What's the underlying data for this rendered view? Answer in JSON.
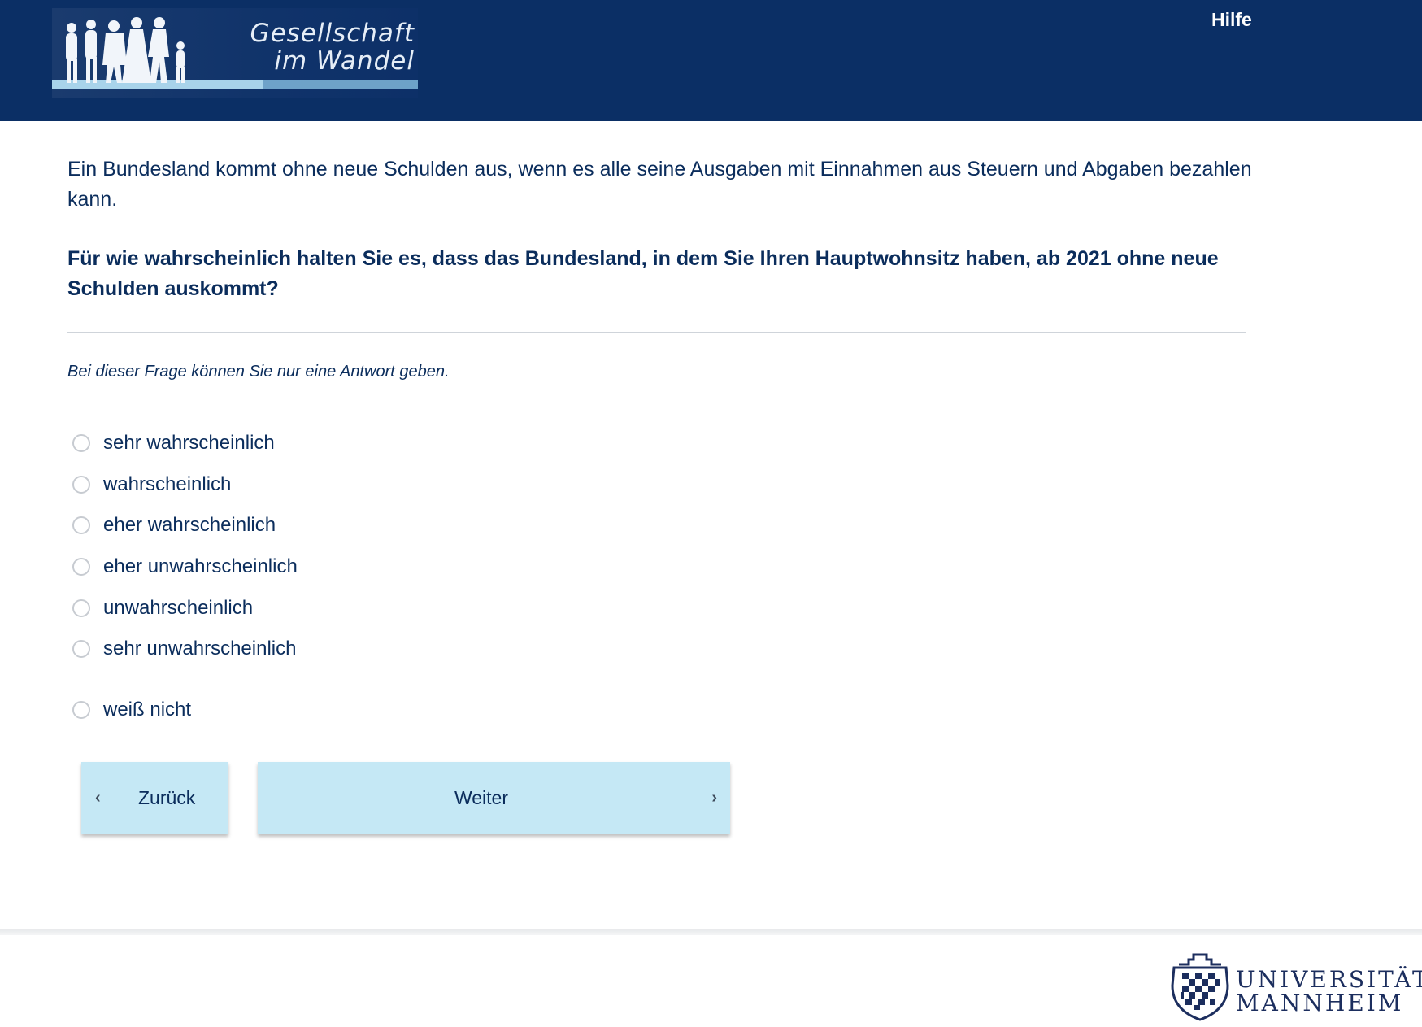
{
  "header": {
    "logo_title_line1": "Gesellschaft",
    "logo_title_line2": "im Wandel",
    "help_label": "Hilfe"
  },
  "main": {
    "intro": "Ein Bundesland kommt ohne neue Schulden aus, wenn es alle seine Ausgaben mit Einnahmen aus Steuern und Abgaben bezahlen kann.",
    "question": "Für wie wahrscheinlich halten Sie es, dass das Bundesland, in dem Sie Ihren Hauptwohnsitz haben, ab 2021 ohne neue Schulden auskommt?",
    "hint": "Bei dieser Frage können Sie nur eine Antwort geben.",
    "options": [
      {
        "label": "sehr wahrscheinlich",
        "selected": false
      },
      {
        "label": "wahrscheinlich",
        "selected": false
      },
      {
        "label": "eher wahrscheinlich",
        "selected": false
      },
      {
        "label": "eher unwahrscheinlich",
        "selected": false
      },
      {
        "label": "unwahrscheinlich",
        "selected": false
      },
      {
        "label": "sehr unwahrscheinlich",
        "selected": false
      },
      {
        "label": "weiß nicht",
        "selected": false
      }
    ]
  },
  "nav": {
    "back_label": "Zurück",
    "back_icon": "‹",
    "next_label": "Weiter",
    "next_icon": "›"
  },
  "footer": {
    "university_line1": "UNIVERSITÄT",
    "university_line2": "MANNHEIM"
  },
  "colors": {
    "header_bg": "#0b2f65",
    "text": "#0b2d5c",
    "button_bg": "#c5e8f5"
  }
}
